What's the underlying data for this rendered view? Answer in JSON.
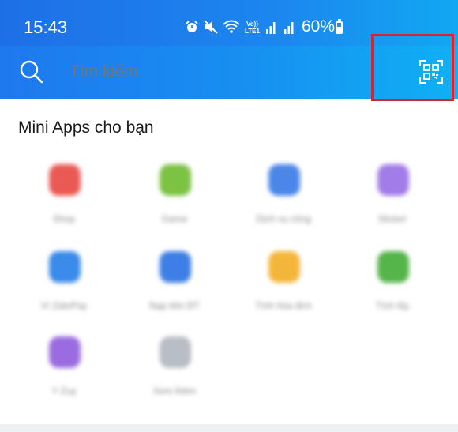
{
  "status": {
    "time": "15:43",
    "network": [
      "Vo))",
      "LTE1"
    ],
    "battery_text": "60%",
    "battery_level": 0.6
  },
  "search": {
    "placeholder": "Tìm kiếm"
  },
  "icons": {
    "search": "search-icon",
    "qr": "qr-scan-icon",
    "alarm": "alarm-icon",
    "mute": "mute-icon",
    "wifi": "wifi-icon",
    "signal": "signal-icon"
  },
  "colors": {
    "header_start": "#1e6fe6",
    "header_end": "#11a8f2",
    "highlight": "#d9232e"
  },
  "section": {
    "title": "Mini Apps cho bạn"
  },
  "apps": [
    {
      "label": "Shop",
      "color": "#ea5a55"
    },
    {
      "label": "Game",
      "color": "#7cc243"
    },
    {
      "label": "Dịch vụ công",
      "color": "#4c86e8"
    },
    {
      "label": "Sticker",
      "color": "#a27ce8"
    },
    {
      "label": "Ví ZaloPay",
      "color": "#3a8bea"
    },
    {
      "label": "Nạp tiền ĐT",
      "color": "#3d7fe6"
    },
    {
      "label": "Tính hóa đơn",
      "color": "#f4b63a"
    },
    {
      "label": "Tích lũy",
      "color": "#55b54a"
    },
    {
      "label": "Y Zuy",
      "color": "#9b6ce0"
    },
    {
      "label": "Xem thêm",
      "color": "#b8bdc6"
    }
  ]
}
